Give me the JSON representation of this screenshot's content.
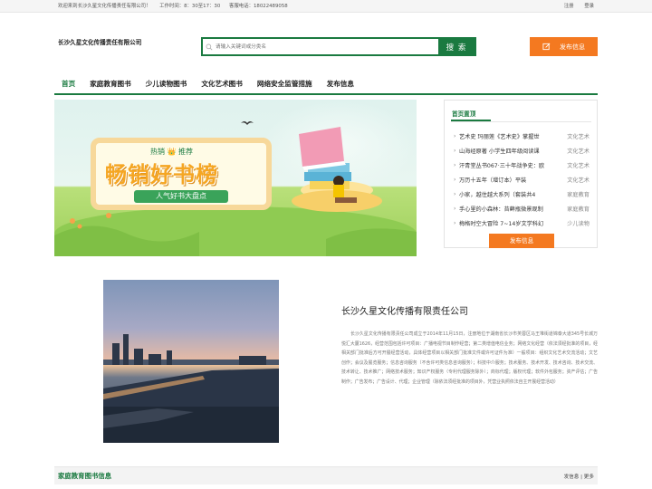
{
  "topbar": {
    "welcome": "欢迎来到长沙久星文化传播责任有限公司！",
    "hours": "工作时间：8：30至17：30",
    "phone": "客服电话：18022489058",
    "register": "注册",
    "login": "登录"
  },
  "header": {
    "company": "长沙久星文化传播责任有限公司",
    "search_placeholder": "请输入关键词或分类名",
    "search_button": "搜 索",
    "publish_button": "发布信息"
  },
  "nav": {
    "items": [
      "首页",
      "家庭教育图书",
      "少儿读物图书",
      "文化艺术图书",
      "网络安全监管措施",
      "发布信息"
    ]
  },
  "banner": {
    "hot": "热销 👑 推荐",
    "title": "畅销好书榜",
    "subtitle": "人气好书大盘点"
  },
  "sidebar": {
    "title": "首页置顶",
    "items": [
      {
        "title": "艺术史 玛丽莲《艺术史》掌握世",
        "category": "文化艺术"
      },
      {
        "title": "山海经原著 小学生四年级阅读课",
        "category": "文化艺术"
      },
      {
        "title": "汗青堂丛书067·三十年战争史：欧",
        "category": "文化艺术"
      },
      {
        "title": "万历十五年（增订本）平装",
        "category": "文化艺术"
      },
      {
        "title": "小家，越住越大系列（套装共4",
        "category": "家庭教育"
      },
      {
        "title": "手心里的小森林：苔藓瓶微景观制",
        "category": "家庭教育"
      },
      {
        "title": "梅格时空大冒险 7~14岁文学科幻",
        "category": "少儿读物"
      }
    ],
    "publish": "发布信息"
  },
  "about": {
    "title": "长沙久星文化传播有限责任公司",
    "text": "长沙久星文化传播有限责任公司成立于2014年11月15日，注册地位于湖南省长沙市芙蓉区马王堆街道锦泰大道345号长城万悦汇大厦1626，经营范围包括许可项目：广播电视节目制作经营；第二类增值电信业务；网络文化经营（依法须经批准的项目，经相关部门批准后方可开展经营活动，具体经营项目以相关部门批准文件或许可证件为准）一般项目：组织文化艺术交流活动；文艺创作；会议及展览服务；信息咨询服务（不含许可类信息咨询服务）；科技中介服务；技术服务、技术开发、技术咨询、技术交流、技术转让、技术推广；网络技术服务；知识产权服务（专利代理服务除外）；商标代理；版权代理；软件外包服务；资产评估；广告制作；广告发布；广告设计、代理；企业管理（除依法须经批准的项目外，凭营业执照依法自主开展经营活动）"
  },
  "section": {
    "title": "家庭教育图书信息",
    "links": "发信息 | 更多"
  },
  "colors": {
    "brand_green": "#1a7a40",
    "accent_orange": "#f47920"
  }
}
